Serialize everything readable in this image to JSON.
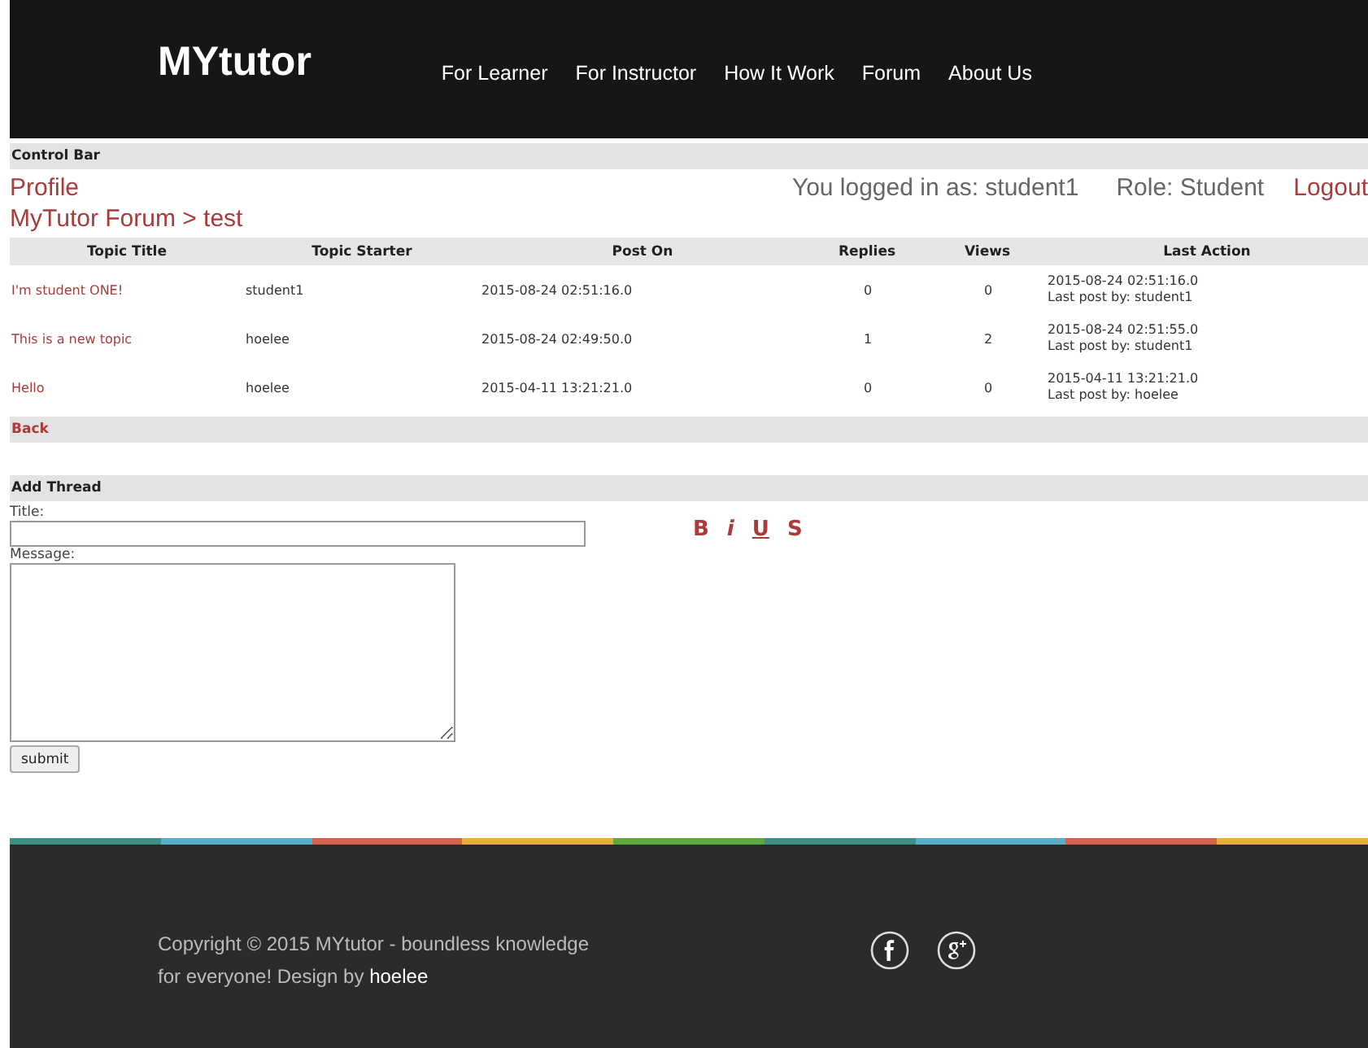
{
  "header": {
    "logo": "MYtutor",
    "nav": [
      {
        "label": "For Learner"
      },
      {
        "label": "For Instructor"
      },
      {
        "label": "How It Work"
      },
      {
        "label": "Forum"
      },
      {
        "label": "About Us"
      }
    ]
  },
  "control_bar": {
    "title": "Control Bar",
    "profile": "Profile",
    "logged_in": "You logged in as: student1",
    "role": "Role: Student",
    "logout": "Logout"
  },
  "breadcrumb": "MyTutor Forum > test",
  "table": {
    "columns": [
      "Topic Title",
      "Topic Starter",
      "Post On",
      "Replies",
      "Views",
      "Last Action"
    ],
    "rows": [
      {
        "title": "I'm student ONE!",
        "starter": "student1",
        "posted": "2015-08-24 02:51:16.0",
        "replies": "0",
        "views": "0",
        "last_time": "2015-08-24 02:51:16.0",
        "last_by": "Last post by: student1"
      },
      {
        "title": "This is a new topic",
        "starter": "hoelee",
        "posted": "2015-08-24 02:49:50.0",
        "replies": "1",
        "views": "2",
        "last_time": "2015-08-24 02:51:55.0",
        "last_by": "Last post by: student1"
      },
      {
        "title": "Hello",
        "starter": "hoelee",
        "posted": "2015-04-11 13:21:21.0",
        "replies": "0",
        "views": "0",
        "last_time": "2015-04-11 13:21:21.0",
        "last_by": "Last post by: hoelee"
      }
    ]
  },
  "back": "Back",
  "add_thread": {
    "title": "Add Thread",
    "title_label": "Title:",
    "message_label": "Message:",
    "format_buttons": [
      {
        "kind": "bold",
        "label": "B"
      },
      {
        "kind": "italic",
        "label": "i"
      },
      {
        "kind": "underline",
        "label": "U"
      },
      {
        "kind": "strike",
        "label": "S"
      }
    ],
    "submit": "submit"
  },
  "footer": {
    "copyright": "Copyright © 2015 MYtutor - boundless knowledge for everyone! Design by **hoelee**"
  }
}
